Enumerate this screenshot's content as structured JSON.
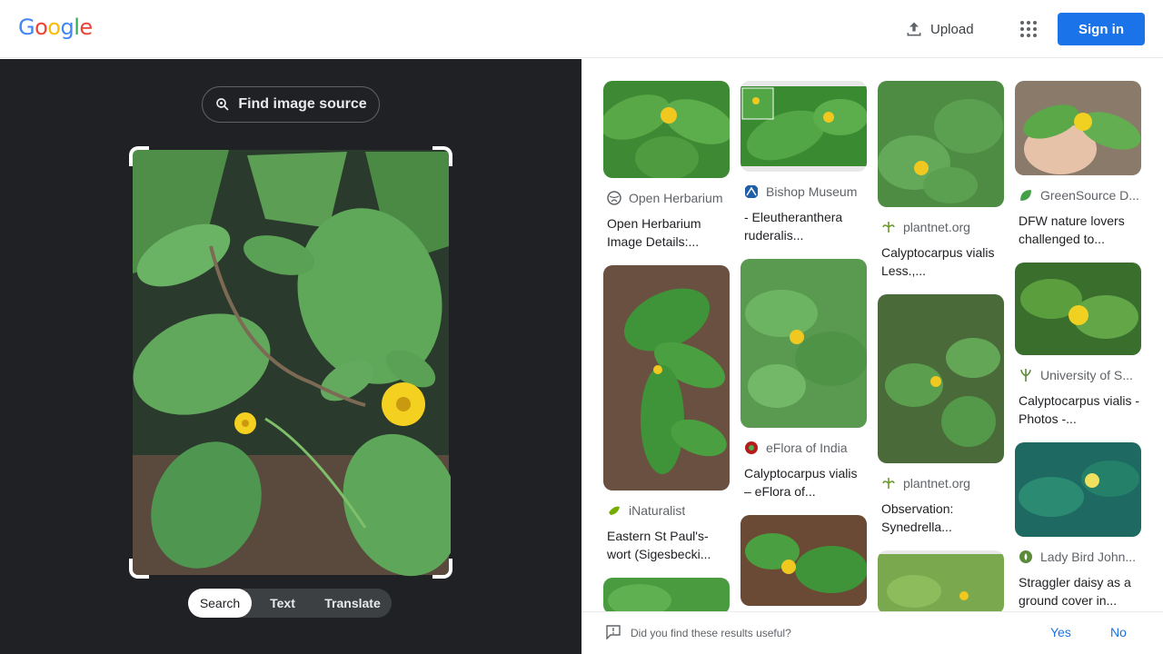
{
  "header": {
    "logo_letters": [
      "G",
      "o",
      "o",
      "g",
      "l",
      "e"
    ],
    "upload_label": "Upload",
    "apps_icon": "apps-grid-icon",
    "signin_label": "Sign in"
  },
  "lens": {
    "find_source_label": "Find image source",
    "modes": [
      "Search",
      "Text",
      "Translate"
    ],
    "active_mode": "Search"
  },
  "results": [
    {
      "source": "Open Herbarium",
      "title": "Open Herbarium Image Details:...",
      "icon": "globe-icon"
    },
    {
      "source": "iNaturalist",
      "title": "Eastern St Paul's-wort (Sigesbecki...",
      "icon": "inaturalist-leaf-icon"
    },
    {
      "source": "Bishop Museum",
      "title": "- Eleutheranthera ruderalis...",
      "icon": "bishop-museum-icon"
    },
    {
      "source": "eFlora of India",
      "title": "Calyptocarpus vialis – eFlora of...",
      "icon": "eflora-icon"
    },
    {
      "source": "plantnet.org",
      "title": "Calyptocarpus vialis Less.,...",
      "icon": "plantnet-icon"
    },
    {
      "source": "plantnet.org",
      "title": "Observation: Synedrella...",
      "icon": "plantnet-icon"
    },
    {
      "source": "GreenSource D...",
      "title": "DFW nature lovers challenged to...",
      "icon": "leaf-icon"
    },
    {
      "source": "University of S...",
      "title": "Calyptocarpus vialis - Photos -...",
      "icon": "university-icon"
    },
    {
      "source": "Lady Bird John...",
      "title": "Straggler daisy as a ground cover in...",
      "icon": "lady-bird-icon"
    }
  ],
  "feedback": {
    "question": "Did you find these results useful?",
    "yes": "Yes",
    "no": "No"
  },
  "colors": {
    "accent": "#1a73e8",
    "dark_bg": "#202124",
    "leaf_green": "#3f9a3a",
    "flower_yellow": "#f4d020"
  }
}
